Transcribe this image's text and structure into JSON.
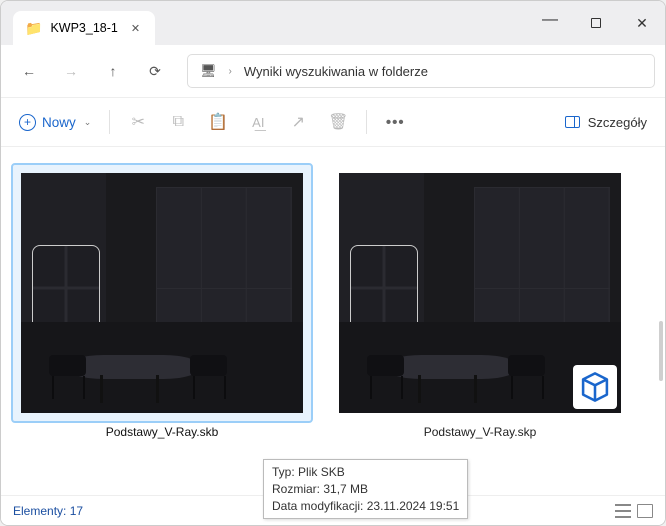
{
  "tab": {
    "title": "KWP3_18-1"
  },
  "breadcrumb": {
    "text": "Wyniki wyszukiwania w folderze"
  },
  "toolbar": {
    "new_label": "Nowy",
    "details_label": "Szczegóły"
  },
  "files": [
    {
      "name": "Podstawy_V-Ray.skb",
      "selected": true,
      "has_app_icon": false
    },
    {
      "name": "Podstawy_V-Ray.skp",
      "selected": false,
      "has_app_icon": true
    }
  ],
  "status": {
    "label": "Elementy:",
    "count": "17"
  },
  "tooltip": {
    "line1_label": "Typ:",
    "line1_value": "Plik SKB",
    "line2_label": "Rozmiar:",
    "line2_value": "31,7 MB",
    "line3_label": "Data modyfikacji:",
    "line3_value": "23.11.2024 19:51"
  }
}
